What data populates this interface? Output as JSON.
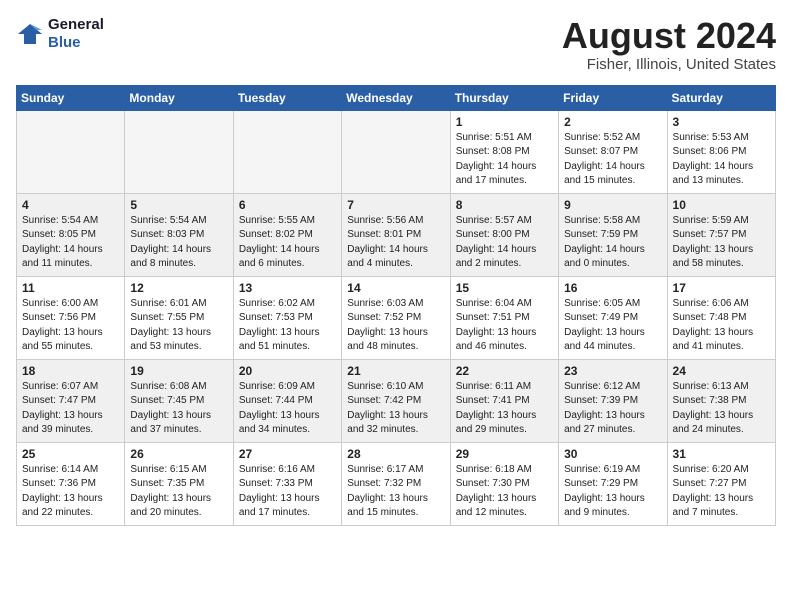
{
  "logo": {
    "line1": "General",
    "line2": "Blue"
  },
  "title": "August 2024",
  "subtitle": "Fisher, Illinois, United States",
  "days_of_week": [
    "Sunday",
    "Monday",
    "Tuesday",
    "Wednesday",
    "Thursday",
    "Friday",
    "Saturday"
  ],
  "weeks": [
    [
      {
        "day": "",
        "info": "",
        "empty": true
      },
      {
        "day": "",
        "info": "",
        "empty": true
      },
      {
        "day": "",
        "info": "",
        "empty": true
      },
      {
        "day": "",
        "info": "",
        "empty": true
      },
      {
        "day": "1",
        "info": "Sunrise: 5:51 AM\nSunset: 8:08 PM\nDaylight: 14 hours\nand 17 minutes."
      },
      {
        "day": "2",
        "info": "Sunrise: 5:52 AM\nSunset: 8:07 PM\nDaylight: 14 hours\nand 15 minutes."
      },
      {
        "day": "3",
        "info": "Sunrise: 5:53 AM\nSunset: 8:06 PM\nDaylight: 14 hours\nand 13 minutes."
      }
    ],
    [
      {
        "day": "4",
        "info": "Sunrise: 5:54 AM\nSunset: 8:05 PM\nDaylight: 14 hours\nand 11 minutes."
      },
      {
        "day": "5",
        "info": "Sunrise: 5:54 AM\nSunset: 8:03 PM\nDaylight: 14 hours\nand 8 minutes."
      },
      {
        "day": "6",
        "info": "Sunrise: 5:55 AM\nSunset: 8:02 PM\nDaylight: 14 hours\nand 6 minutes."
      },
      {
        "day": "7",
        "info": "Sunrise: 5:56 AM\nSunset: 8:01 PM\nDaylight: 14 hours\nand 4 minutes."
      },
      {
        "day": "8",
        "info": "Sunrise: 5:57 AM\nSunset: 8:00 PM\nDaylight: 14 hours\nand 2 minutes."
      },
      {
        "day": "9",
        "info": "Sunrise: 5:58 AM\nSunset: 7:59 PM\nDaylight: 14 hours\nand 0 minutes."
      },
      {
        "day": "10",
        "info": "Sunrise: 5:59 AM\nSunset: 7:57 PM\nDaylight: 13 hours\nand 58 minutes."
      }
    ],
    [
      {
        "day": "11",
        "info": "Sunrise: 6:00 AM\nSunset: 7:56 PM\nDaylight: 13 hours\nand 55 minutes."
      },
      {
        "day": "12",
        "info": "Sunrise: 6:01 AM\nSunset: 7:55 PM\nDaylight: 13 hours\nand 53 minutes."
      },
      {
        "day": "13",
        "info": "Sunrise: 6:02 AM\nSunset: 7:53 PM\nDaylight: 13 hours\nand 51 minutes."
      },
      {
        "day": "14",
        "info": "Sunrise: 6:03 AM\nSunset: 7:52 PM\nDaylight: 13 hours\nand 48 minutes."
      },
      {
        "day": "15",
        "info": "Sunrise: 6:04 AM\nSunset: 7:51 PM\nDaylight: 13 hours\nand 46 minutes."
      },
      {
        "day": "16",
        "info": "Sunrise: 6:05 AM\nSunset: 7:49 PM\nDaylight: 13 hours\nand 44 minutes."
      },
      {
        "day": "17",
        "info": "Sunrise: 6:06 AM\nSunset: 7:48 PM\nDaylight: 13 hours\nand 41 minutes."
      }
    ],
    [
      {
        "day": "18",
        "info": "Sunrise: 6:07 AM\nSunset: 7:47 PM\nDaylight: 13 hours\nand 39 minutes."
      },
      {
        "day": "19",
        "info": "Sunrise: 6:08 AM\nSunset: 7:45 PM\nDaylight: 13 hours\nand 37 minutes."
      },
      {
        "day": "20",
        "info": "Sunrise: 6:09 AM\nSunset: 7:44 PM\nDaylight: 13 hours\nand 34 minutes."
      },
      {
        "day": "21",
        "info": "Sunrise: 6:10 AM\nSunset: 7:42 PM\nDaylight: 13 hours\nand 32 minutes."
      },
      {
        "day": "22",
        "info": "Sunrise: 6:11 AM\nSunset: 7:41 PM\nDaylight: 13 hours\nand 29 minutes."
      },
      {
        "day": "23",
        "info": "Sunrise: 6:12 AM\nSunset: 7:39 PM\nDaylight: 13 hours\nand 27 minutes."
      },
      {
        "day": "24",
        "info": "Sunrise: 6:13 AM\nSunset: 7:38 PM\nDaylight: 13 hours\nand 24 minutes."
      }
    ],
    [
      {
        "day": "25",
        "info": "Sunrise: 6:14 AM\nSunset: 7:36 PM\nDaylight: 13 hours\nand 22 minutes."
      },
      {
        "day": "26",
        "info": "Sunrise: 6:15 AM\nSunset: 7:35 PM\nDaylight: 13 hours\nand 20 minutes."
      },
      {
        "day": "27",
        "info": "Sunrise: 6:16 AM\nSunset: 7:33 PM\nDaylight: 13 hours\nand 17 minutes."
      },
      {
        "day": "28",
        "info": "Sunrise: 6:17 AM\nSunset: 7:32 PM\nDaylight: 13 hours\nand 15 minutes."
      },
      {
        "day": "29",
        "info": "Sunrise: 6:18 AM\nSunset: 7:30 PM\nDaylight: 13 hours\nand 12 minutes."
      },
      {
        "day": "30",
        "info": "Sunrise: 6:19 AM\nSunset: 7:29 PM\nDaylight: 13 hours\nand 9 minutes."
      },
      {
        "day": "31",
        "info": "Sunrise: 6:20 AM\nSunset: 7:27 PM\nDaylight: 13 hours\nand 7 minutes."
      }
    ]
  ]
}
